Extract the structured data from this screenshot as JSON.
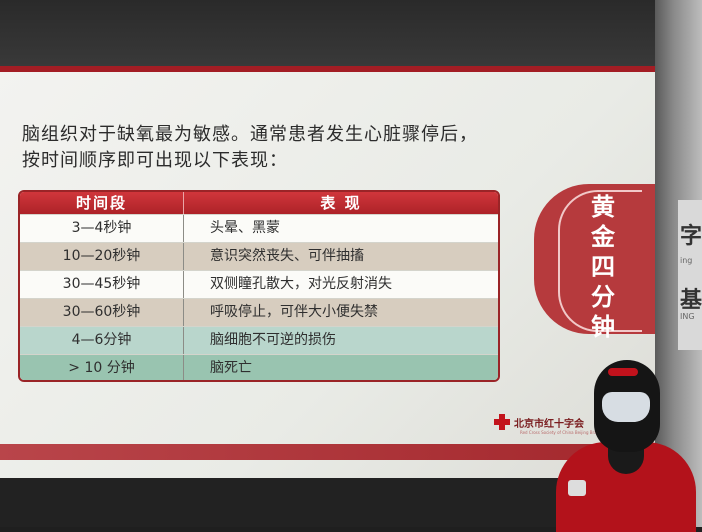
{
  "slide": {
    "intro_line1": "脑组织对于缺氧最为敏感。通常患者发生心脏骤停后，",
    "intro_line2": "按时间顺序即可出现以下表现：",
    "table": {
      "header_time": "时间段",
      "header_symptom": "表 现",
      "rows": [
        {
          "time": "3—4秒钟",
          "symptom": "头晕、黑蒙"
        },
        {
          "time": "10—20秒钟",
          "symptom": "意识突然丧失、可伴抽搐"
        },
        {
          "time": "30—45秒钟",
          "symptom": "双侧瞳孔散大，对光反射消失"
        },
        {
          "time": "30—60秒钟",
          "symptom": "呼吸停止，可伴大小便失禁"
        },
        {
          "time": "4—6分钟",
          "symptom": "脑细胞不可逆的损伤"
        },
        {
          "time": "> 10 分钟",
          "symptom": "脑死亡"
        }
      ]
    },
    "badge_chars": [
      "黄",
      "金",
      "四",
      "分",
      "钟"
    ],
    "logo_text": "北京市红十字会",
    "logo_subtext": "Red Cross Society of China Beijing Branch"
  },
  "background": {
    "banner_char_1": "字",
    "banner_char_2": "基",
    "banner_sub_1": "ing",
    "banner_sub_2": "ING"
  },
  "colors": {
    "accent_red": "#b63a3d",
    "header_red": "#c0282f",
    "row_tan": "#d7cdbf",
    "row_green_light": "#b9d6cc",
    "row_green": "#99c4b0"
  }
}
